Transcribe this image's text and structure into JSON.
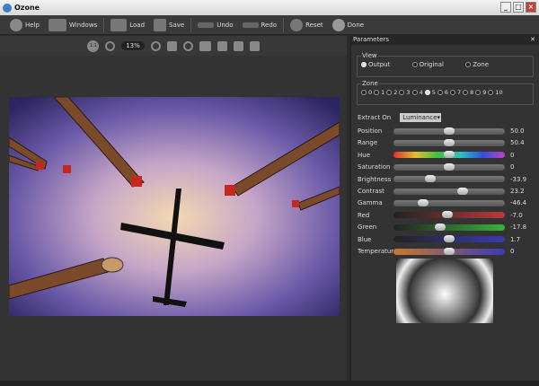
{
  "window": {
    "title": "Ozone",
    "controls": [
      "_",
      "□",
      "×"
    ]
  },
  "toolbar": [
    {
      "label": "Help",
      "icon": "help-icon"
    },
    {
      "label": "Windows",
      "icon": "windows-icon"
    },
    {
      "label": "Load",
      "icon": "load-icon"
    },
    {
      "label": "Save",
      "icon": "save-icon"
    },
    {
      "label": "Undo",
      "icon": "undo-icon"
    },
    {
      "label": "Redo",
      "icon": "redo-icon"
    },
    {
      "label": "Reset",
      "icon": "reset-icon"
    },
    {
      "label": "Done",
      "icon": "gear-icon"
    }
  ],
  "viewbar": {
    "actual_size": "1:1",
    "zoom": "13%"
  },
  "panel": {
    "title": "Parameters",
    "view": {
      "legend": "View",
      "options": [
        "Output",
        "Original",
        "Zone"
      ],
      "selected": "Output"
    },
    "zone": {
      "legend": "Zone",
      "options": [
        "0",
        "1",
        "2",
        "3",
        "4",
        "5",
        "6",
        "7",
        "8",
        "9",
        "10"
      ],
      "selected": "5"
    },
    "extract": {
      "label": "Extract On",
      "value": "Luminance"
    },
    "sliders": [
      {
        "label": "Position",
        "value": "50.0",
        "fraction": 0.5,
        "track": "gray"
      },
      {
        "label": "Range",
        "value": "50.4",
        "fraction": 0.5,
        "track": "gray"
      },
      {
        "label": "Hue",
        "value": "0",
        "fraction": 0.5,
        "track": "hue"
      },
      {
        "label": "Saturation",
        "value": "0",
        "fraction": 0.5,
        "track": "gray"
      },
      {
        "label": "Brightness",
        "value": "-33.9",
        "fraction": 0.33,
        "track": "gray"
      },
      {
        "label": "Contrast",
        "value": "23.2",
        "fraction": 0.62,
        "track": "gray"
      },
      {
        "label": "Gamma",
        "value": "-46.4",
        "fraction": 0.27,
        "track": "gray"
      },
      {
        "label": "Red",
        "value": "-7.0",
        "fraction": 0.48,
        "track": "red"
      },
      {
        "label": "Green",
        "value": "-17.8",
        "fraction": 0.42,
        "track": "green"
      },
      {
        "label": "Blue",
        "value": "1.7",
        "fraction": 0.5,
        "track": "blue"
      },
      {
        "label": "Temperature",
        "value": "0",
        "fraction": 0.5,
        "track": "temp"
      }
    ]
  },
  "colors": {
    "red": "#b93a3a",
    "green": "#3bb13b",
    "blue": "#3a3ab0",
    "temp_warm": "#c87a2a",
    "temp_cool": "#3a3ab8"
  }
}
